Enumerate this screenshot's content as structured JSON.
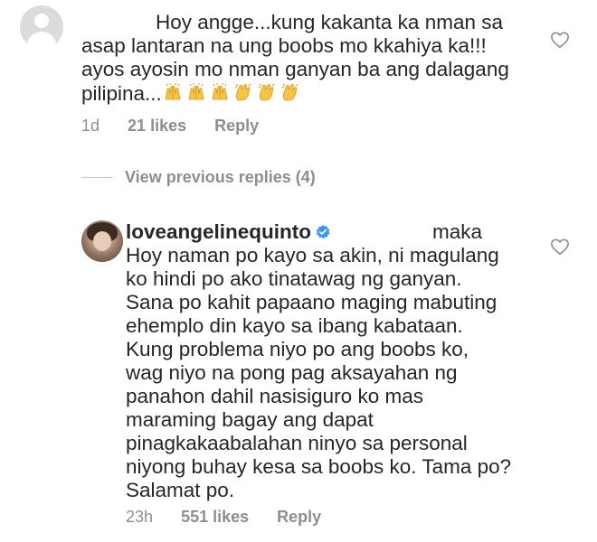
{
  "comment1": {
    "avatar_icon": "default-avatar-icon",
    "lines": [
      "Hoy angge...kung kakanta ka nman sa",
      "asap lantaran na ung boobs mo kkahiya ka!!!",
      "ayos ayosin mo nman ganyan ba ang dalagang",
      "pilipina..."
    ],
    "emojis": [
      "raising-hands-emoji",
      "raising-hands-emoji",
      "raising-hands-emoji",
      "clapping-hands-emoji",
      "clapping-hands-emoji",
      "clapping-hands-emoji"
    ],
    "time": "1d",
    "likes": "21 likes",
    "reply": "Reply",
    "like_icon": "heart-outline-icon"
  },
  "view_replies": {
    "label": "View previous replies (4)"
  },
  "reply1": {
    "avatar_icon": "profile-photo-avatar",
    "username": "loveangelinequinto",
    "verified_icon": "verified-badge-icon",
    "first_line_tail": "maka",
    "lines": [
      "Hoy naman po kayo sa akin, ni magulang",
      "ko hindi po ako tinatawag ng ganyan.",
      "Sana po kahit papaano maging mabuting",
      "ehemplo din kayo sa ibang kabataan.",
      "Kung problema niyo po ang boobs ko,",
      "wag niyo na pong pag aksayahan ng",
      "panahon dahil nasisiguro ko mas",
      "maraming bagay ang dapat",
      "pinagkakaabalahan ninyo sa personal",
      "niyong buhay kesa sa boobs ko. Tama po?",
      "Salamat po."
    ],
    "time": "23h",
    "likes": "551 likes",
    "reply": "Reply",
    "like_icon": "heart-outline-icon",
    "accent_color": "#3897f0"
  }
}
